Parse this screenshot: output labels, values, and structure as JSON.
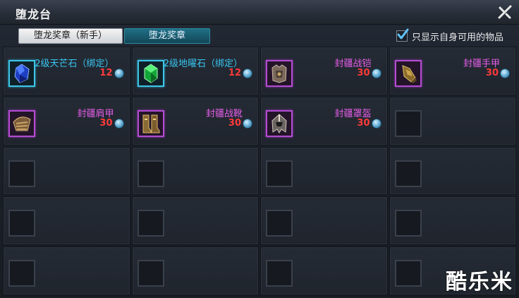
{
  "window": {
    "title": "堕龙台"
  },
  "tabs": [
    {
      "label": "堕龙奖章（新手）",
      "active": true
    },
    {
      "label": "堕龙奖章",
      "active": false
    }
  ],
  "filter": {
    "label": "只显示自身可用的物品",
    "checked": true
  },
  "items": [
    {
      "name": "2级天芒石（绑定）",
      "price": "12",
      "quality": "cyan",
      "icon": "blue-gem-icon"
    },
    {
      "name": "2级地曜石（绑定）",
      "price": "12",
      "quality": "cyan",
      "icon": "green-gem-icon"
    },
    {
      "name": "封疆战铠",
      "price": "30",
      "quality": "purple",
      "icon": "armor-chest-icon"
    },
    {
      "name": "封疆手甲",
      "price": "30",
      "quality": "purple",
      "icon": "gauntlet-icon"
    },
    {
      "name": "封疆肩甲",
      "price": "30",
      "quality": "purple",
      "icon": "shoulder-armor-icon"
    },
    {
      "name": "封疆战靴",
      "price": "30",
      "quality": "purple",
      "icon": "boots-icon"
    },
    {
      "name": "封疆罩盔",
      "price": "30",
      "quality": "purple",
      "icon": "helmet-icon"
    }
  ],
  "watermark": "酷乐米",
  "colors": {
    "cyan_quality": "#38c6f0",
    "purple_quality": "#e45ee8",
    "price": "#ff3b3b"
  }
}
